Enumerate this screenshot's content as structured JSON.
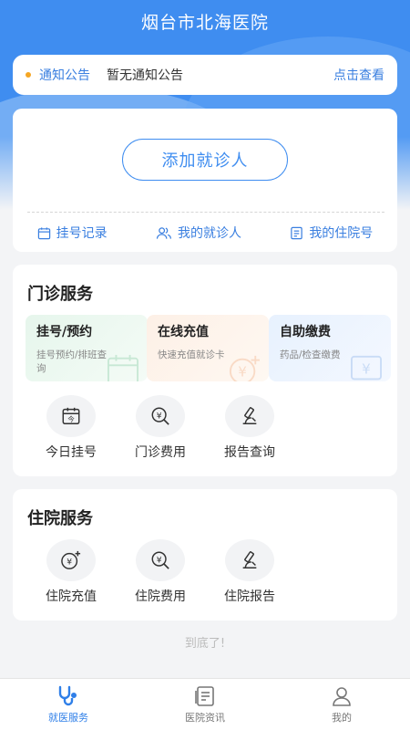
{
  "header": {
    "title": "烟台市北海医院"
  },
  "notice": {
    "label": "通知公告",
    "text": "暂无通知公告",
    "link": "点击查看"
  },
  "patient": {
    "add_button": "添加就诊人",
    "links": [
      {
        "label": "挂号记录",
        "icon": "calendar-icon"
      },
      {
        "label": "我的就诊人",
        "icon": "users-icon"
      },
      {
        "label": "我的住院号",
        "icon": "document-icon"
      }
    ]
  },
  "outpatient": {
    "title": "门诊服务",
    "tiles": [
      {
        "title": "挂号/预约",
        "subtitle": "挂号预约/排班查询",
        "icon": "calendar-icon"
      },
      {
        "title": "在线充值",
        "subtitle": "快速充值就诊卡",
        "icon": "yen-plus-icon"
      },
      {
        "title": "自助缴费",
        "subtitle": "药品/检查缴费",
        "icon": "yen-screen-icon"
      }
    ],
    "icons": [
      {
        "label": "今日挂号",
        "icon": "calendar-today-icon"
      },
      {
        "label": "门诊费用",
        "icon": "yen-search-icon"
      },
      {
        "label": "报告查询",
        "icon": "microscope-icon"
      }
    ]
  },
  "inpatient": {
    "title": "住院服务",
    "icons": [
      {
        "label": "住院充值",
        "icon": "yen-plus-icon"
      },
      {
        "label": "住院费用",
        "icon": "yen-search-icon"
      },
      {
        "label": "住院报告",
        "icon": "microscope-icon"
      }
    ]
  },
  "footer_note": "到底了!",
  "tabbar": {
    "tabs": [
      {
        "label": "就医服务",
        "icon": "stethoscope-icon",
        "active": true
      },
      {
        "label": "医院资讯",
        "icon": "news-icon",
        "active": false
      },
      {
        "label": "我的",
        "icon": "user-icon",
        "active": false
      }
    ]
  },
  "colors": {
    "primary": "#3f8df0",
    "link": "#3a7fe0",
    "dot": "#f5a623"
  }
}
